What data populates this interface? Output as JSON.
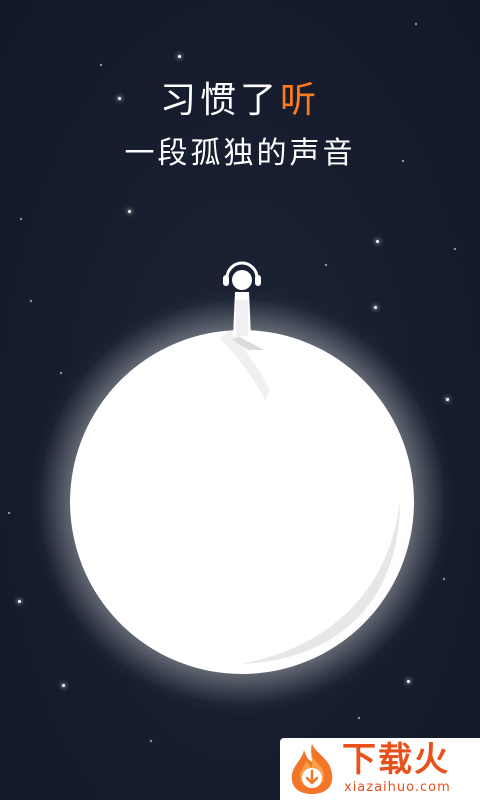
{
  "splash": {
    "headline_main": "习惯了",
    "headline_accent": "听",
    "subline": "一段孤独的声音"
  },
  "watermark": {
    "brand_cn": "下载火",
    "brand_url": "xiazaihuo.com"
  },
  "colors": {
    "background": "#151c2d",
    "accent": "#ff7a1a",
    "planet": "#ffffff",
    "watermark": "#e8511c"
  },
  "icons": {
    "listener": "person-with-headphones-icon",
    "logo": "fire-download-logo-icon"
  }
}
